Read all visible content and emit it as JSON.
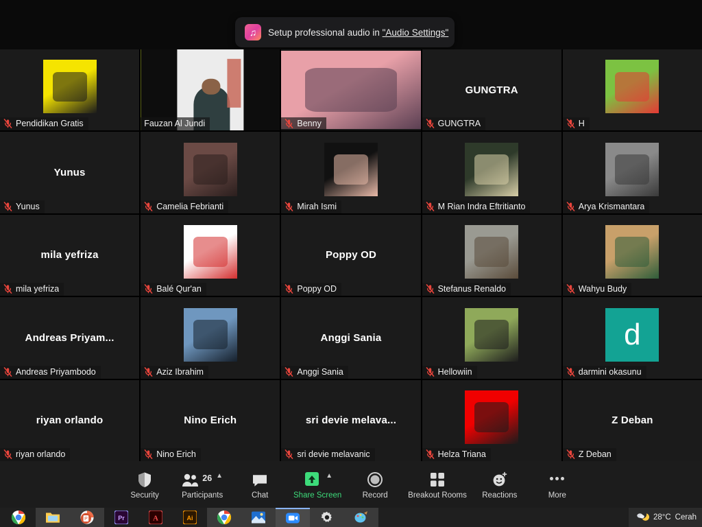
{
  "app": {
    "name": "Zoom Meeting",
    "platform": "Windows"
  },
  "notification": {
    "icon": "music-note-icon",
    "text_before": "Setup professional audio in ",
    "link_text": "\"Audio Settings\""
  },
  "grid": {
    "columns": 5,
    "rows": 5,
    "active_speaker_border_color": "#d4e830",
    "mute_icon": "microphone-muted-icon",
    "tiles": [
      {
        "name": "Pendidikan Gratis",
        "display_style": "avatar",
        "muted": true,
        "active": false,
        "avatar_kind": "image",
        "avatar_colors": [
          "#f5e400",
          "#1b1b1b"
        ]
      },
      {
        "name": "Fauzan Al Jundi",
        "display_style": "video",
        "muted": false,
        "active": true,
        "avatar_kind": "video",
        "avatar_colors": [
          "#ececec",
          "#2f3f40"
        ]
      },
      {
        "name": "Benny",
        "display_style": "avatar",
        "muted": true,
        "active": false,
        "avatar_kind": "image-wide",
        "avatar_colors": [
          "#e8a0a8",
          "#5a3f52"
        ]
      },
      {
        "name": "GUNGTRA",
        "display_style": "name",
        "muted": true,
        "active": false,
        "avatar_kind": "none",
        "avatar_colors": []
      },
      {
        "name": "H",
        "display_style": "avatar",
        "muted": true,
        "active": false,
        "avatar_kind": "image",
        "avatar_colors": [
          "#7cc242",
          "#e53935"
        ]
      },
      {
        "name": "Yunus",
        "display_style": "name",
        "muted": true,
        "active": false,
        "avatar_kind": "none",
        "avatar_colors": []
      },
      {
        "name": "Camelia Febrianti",
        "display_style": "avatar",
        "muted": true,
        "active": false,
        "avatar_kind": "image",
        "avatar_colors": [
          "#6b4a45",
          "#2b1f1e"
        ]
      },
      {
        "name": "Mirah Ismi",
        "display_style": "avatar",
        "muted": true,
        "active": false,
        "avatar_kind": "image",
        "avatar_colors": [
          "#111111",
          "#e8b9a8"
        ]
      },
      {
        "name": "M Rian Indra Eftritianto",
        "display_style": "avatar",
        "muted": true,
        "active": false,
        "avatar_kind": "image",
        "avatar_colors": [
          "#2e3a2a",
          "#d8cfa8"
        ]
      },
      {
        "name": "Arya Krismantara",
        "display_style": "avatar",
        "muted": true,
        "active": false,
        "avatar_kind": "image",
        "avatar_colors": [
          "#8a8a8a",
          "#3a3a3a"
        ]
      },
      {
        "name": "mila yefriza",
        "display_style": "name",
        "muted": true,
        "active": false,
        "avatar_kind": "none",
        "avatar_colors": []
      },
      {
        "name": "Balé Qur'an",
        "display_style": "avatar",
        "muted": true,
        "active": false,
        "avatar_kind": "image",
        "avatar_colors": [
          "#ffffff",
          "#d32f2f"
        ]
      },
      {
        "name": "Poppy OD",
        "display_style": "name",
        "muted": true,
        "active": false,
        "avatar_kind": "none",
        "avatar_colors": []
      },
      {
        "name": "Stefanus Renaldo",
        "display_style": "avatar",
        "muted": true,
        "active": false,
        "avatar_kind": "image",
        "avatar_colors": [
          "#9a9a92",
          "#5a4b3a"
        ]
      },
      {
        "name": "Wahyu Budy",
        "display_style": "avatar",
        "muted": true,
        "active": false,
        "avatar_kind": "image",
        "avatar_colors": [
          "#c8a06a",
          "#2f5d3a"
        ]
      },
      {
        "name": "Andreas Priyambodo",
        "display_style": "name",
        "name_truncated": "Andreas  Priyam...",
        "muted": true,
        "active": false,
        "avatar_kind": "none",
        "avatar_colors": []
      },
      {
        "name": "Aziz Ibrahim",
        "display_style": "avatar",
        "muted": true,
        "active": false,
        "avatar_kind": "image",
        "avatar_colors": [
          "#6f97bf",
          "#16202c"
        ]
      },
      {
        "name": "Anggi Sania",
        "display_style": "name",
        "muted": true,
        "active": false,
        "avatar_kind": "none",
        "avatar_colors": []
      },
      {
        "name": "Hellowiin",
        "display_style": "avatar",
        "muted": true,
        "active": false,
        "avatar_kind": "image",
        "avatar_colors": [
          "#8fa95a",
          "#1d1d1d"
        ]
      },
      {
        "name": "darmini okasunu",
        "display_style": "avatar",
        "muted": true,
        "active": false,
        "avatar_kind": "letter",
        "avatar_letter": "d",
        "avatar_colors": [
          "#13a394"
        ]
      },
      {
        "name": "riyan orlando",
        "display_style": "name",
        "muted": true,
        "active": false,
        "avatar_kind": "none",
        "avatar_colors": []
      },
      {
        "name": "Nino Erich",
        "display_style": "name",
        "muted": true,
        "active": false,
        "avatar_kind": "none",
        "avatar_colors": []
      },
      {
        "name": "sri devie melavanic",
        "display_style": "name",
        "name_truncated": "sri  devie  melava...",
        "muted": true,
        "active": false,
        "avatar_kind": "none",
        "avatar_colors": []
      },
      {
        "name": "Helza Triana",
        "display_style": "avatar",
        "muted": true,
        "active": false,
        "avatar_kind": "image",
        "avatar_colors": [
          "#f00000",
          "#1b1b1b"
        ]
      },
      {
        "name": "Z Deban",
        "display_style": "name",
        "muted": true,
        "active": false,
        "avatar_kind": "none",
        "avatar_colors": []
      }
    ]
  },
  "toolbar": {
    "items": [
      {
        "label": "Security",
        "icon": "shield-icon",
        "caret": false,
        "badge": "",
        "highlight": false
      },
      {
        "label": "Participants",
        "icon": "participants-icon",
        "caret": true,
        "badge": "26",
        "highlight": false
      },
      {
        "label": "Chat",
        "icon": "chat-bubble-icon",
        "caret": false,
        "badge": "",
        "highlight": false
      },
      {
        "label": "Share Screen",
        "icon": "share-screen-icon",
        "caret": true,
        "badge": "",
        "highlight": true
      },
      {
        "label": "Record",
        "icon": "record-circle-icon",
        "caret": false,
        "badge": "",
        "highlight": false
      },
      {
        "label": "Breakout Rooms",
        "icon": "breakout-rooms-icon",
        "caret": false,
        "badge": "",
        "highlight": false
      },
      {
        "label": "Reactions",
        "icon": "reactions-smiley-icon",
        "caret": false,
        "badge": "",
        "highlight": false
      },
      {
        "label": "More",
        "icon": "more-dots-icon",
        "caret": false,
        "badge": "",
        "highlight": false
      }
    ],
    "share_screen_color": "#3ddb7a"
  },
  "taskbar": {
    "apps": [
      {
        "name": "google-chrome-icon",
        "boxed": false,
        "active": false
      },
      {
        "name": "file-explorer-icon",
        "boxed": true,
        "active": false
      },
      {
        "name": "powerpoint-icon",
        "boxed": true,
        "active": false
      },
      {
        "name": "premiere-pro-icon",
        "boxed": false,
        "active": false
      },
      {
        "name": "adobe-acrobat-icon",
        "boxed": false,
        "active": false
      },
      {
        "name": "illustrator-icon",
        "boxed": false,
        "active": false
      },
      {
        "name": "chrome-window-icon",
        "boxed": true,
        "active": false
      },
      {
        "name": "photos-icon",
        "boxed": true,
        "active": false
      },
      {
        "name": "zoom-app-icon",
        "boxed": true,
        "active": true
      },
      {
        "name": "settings-gear-icon",
        "boxed": true,
        "active": false
      },
      {
        "name": "paint-icon",
        "boxed": true,
        "active": false
      }
    ],
    "tray": {
      "weather_icon": "moon-cloud-icon",
      "temperature": "28°C",
      "condition": "Cerah"
    }
  }
}
